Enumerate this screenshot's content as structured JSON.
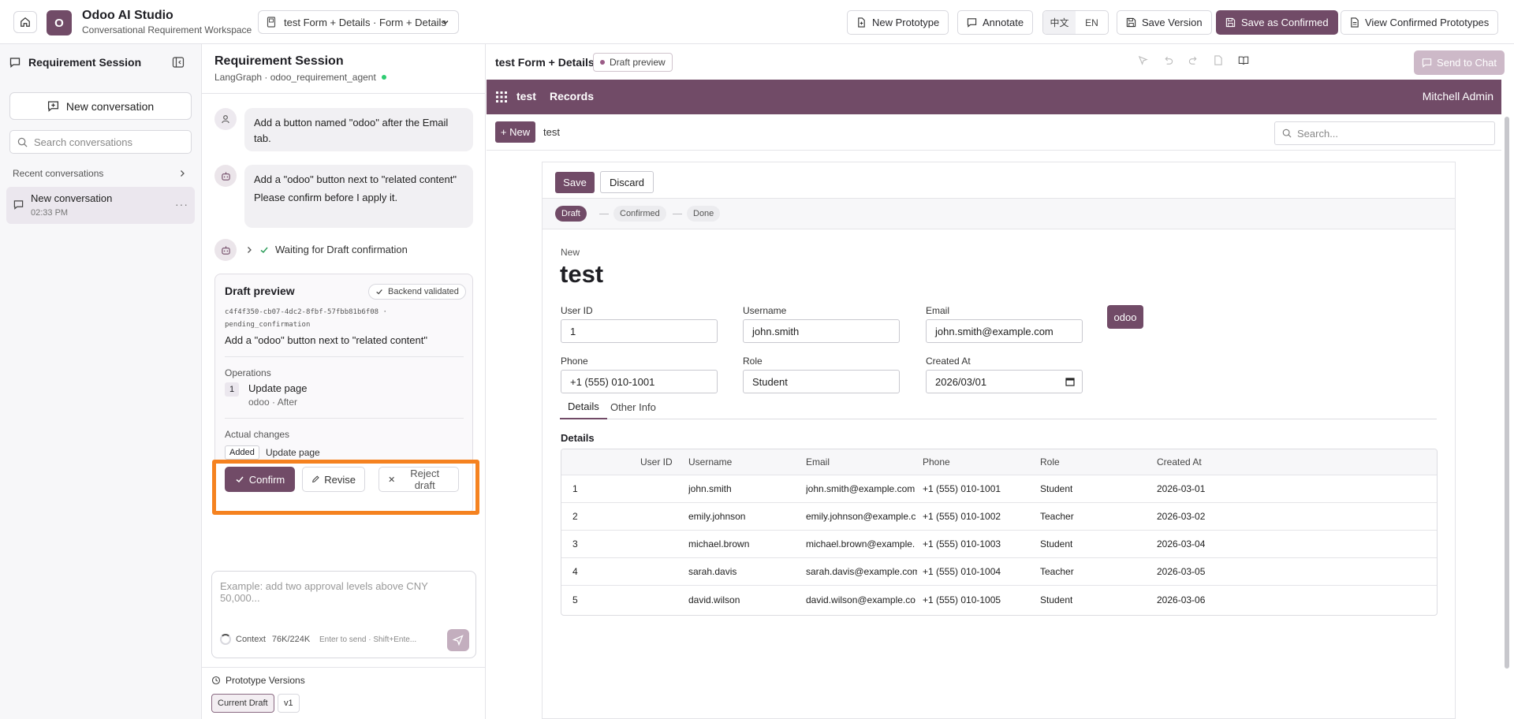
{
  "header": {
    "brand_letter": "O",
    "title": "Odoo AI Studio",
    "subtitle": "Conversational Requirement Workspace",
    "breadcrumb": "test Form + Details · Form + Details",
    "new_prototype": "New Prototype",
    "annotate": "Annotate",
    "lang_zh": "中文",
    "lang_en": "EN",
    "save_version": "Save Version",
    "save_confirmed": "Save as Confirmed",
    "view_confirmed": "View Confirmed Prototypes"
  },
  "sidebar": {
    "title": "Requirement Session",
    "new_conversation": "New conversation",
    "search_placeholder": "Search conversations",
    "recent_label": "Recent conversations",
    "conversations": [
      {
        "title": "New conversation",
        "time": "02:33 PM"
      }
    ]
  },
  "chat": {
    "title": "Requirement Session",
    "subtitle": "LangGraph · odoo_requirement_agent",
    "messages": [
      {
        "role": "user",
        "text": "Add a button named \"odoo\" after the Email tab."
      },
      {
        "role": "assistant",
        "line1": "Add a \"odoo\" button next to \"related content\"",
        "line2": "Please confirm before I apply it."
      }
    ],
    "waiting": "Waiting for Draft confirmation",
    "draft": {
      "title": "Draft preview",
      "badge": "Backend validated",
      "hash_line1": "c4f4f350-cb07-4dc2-8fbf-57fbb81b6f08 ·",
      "hash_line2": "pending_confirmation",
      "description": "Add a \"odoo\" button next to \"related content\"",
      "operations_label": "Operations",
      "op_num": "1",
      "op_title": "Update page",
      "op_sub": "odoo · After",
      "changes_label": "Actual changes",
      "change_tag": "Added",
      "change_title": "Update page",
      "confirm": "Confirm",
      "revise": "Revise",
      "reject": "Reject draft"
    },
    "composer_placeholder": "Example: add two approval levels above CNY 50,000...",
    "context_label": "Context",
    "context_value": "76K/224K",
    "hint": "Enter to send · Shift+Ente...",
    "versions_label": "Prototype Versions",
    "versions": [
      "Current Draft",
      "v1"
    ]
  },
  "preview": {
    "title": "test Form + Details",
    "status_pill": "Draft preview",
    "send_to_chat": "Send to Chat",
    "nav": {
      "app": "test",
      "menu": "Records",
      "user": "Mitchell Admin"
    },
    "control": {
      "new": "+ New",
      "breadcrumb": "test",
      "search_placeholder": "Search..."
    },
    "form": {
      "save": "Save",
      "discard": "Discard",
      "statuses": [
        "Draft",
        "Confirmed",
        "Done"
      ],
      "record_label": "New",
      "record_title": "test",
      "fields": {
        "user_id": {
          "label": "User ID",
          "value": "1"
        },
        "username": {
          "label": "Username",
          "value": "john.smith"
        },
        "email": {
          "label": "Email",
          "value": "john.smith@example.com"
        },
        "phone": {
          "label": "Phone",
          "value": "+1 (555) 010-1001"
        },
        "role": {
          "label": "Role",
          "value": "Student"
        },
        "created_at": {
          "label": "Created At",
          "value": "2026/03/01"
        }
      },
      "odoo_button": "odoo",
      "tabs": [
        "Details",
        "Other Info"
      ],
      "details_heading": "Details",
      "table": {
        "headers": [
          "User ID",
          "Username",
          "Email",
          "Phone",
          "Role",
          "Created At"
        ],
        "rows": [
          [
            "1",
            "john.smith",
            "john.smith@example.com",
            "+1 (555) 010-1001",
            "Student",
            "2026-03-01"
          ],
          [
            "2",
            "emily.johnson",
            "emily.johnson@example.c",
            "+1 (555) 010-1002",
            "Teacher",
            "2026-03-02"
          ],
          [
            "3",
            "michael.brown",
            "michael.brown@example.",
            "+1 (555) 010-1003",
            "Student",
            "2026-03-04"
          ],
          [
            "4",
            "sarah.davis",
            "sarah.davis@example.com",
            "+1 (555) 010-1004",
            "Teacher",
            "2026-03-05"
          ],
          [
            "5",
            "david.wilson",
            "david.wilson@example.co",
            "+1 (555) 010-1005",
            "Student",
            "2026-03-06"
          ]
        ]
      }
    }
  },
  "colors": {
    "brand": "#714b67",
    "highlight": "#f58220",
    "online": "#2ecc71"
  }
}
